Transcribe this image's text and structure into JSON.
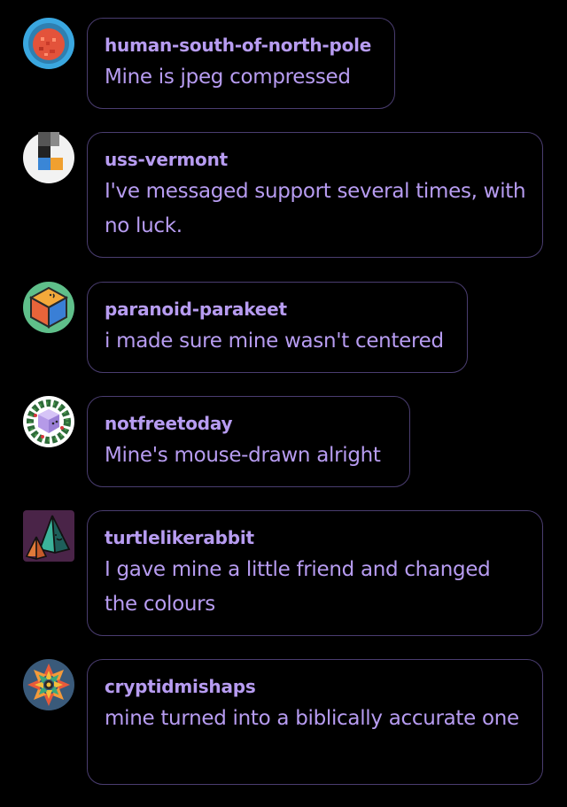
{
  "replies": [
    {
      "username": "human-south-of-north-pole",
      "message": "Mine is jpeg compressed",
      "avatar_icon": "red-blob-avatar-icon"
    },
    {
      "username": "uss-vermont",
      "message": "I've messaged support several times, with no luck.",
      "avatar_icon": "color-blocks-avatar-icon"
    },
    {
      "username": "paranoid-parakeet",
      "message": "i made sure mine wasn't centered",
      "avatar_icon": "isometric-cube-avatar-icon"
    },
    {
      "username": "notfreetoday",
      "message": "Mine's mouse-drawn alright",
      "avatar_icon": "wreath-cube-avatar-icon"
    },
    {
      "username": "turtlelikerabbit",
      "message": "I gave mine a little friend and changed the colours",
      "avatar_icon": "pyramid-friends-avatar-icon"
    },
    {
      "username": "cryptidmishaps",
      "message": "mine turned into a biblically accurate one",
      "avatar_icon": "kaleidoscope-avatar-icon"
    }
  ],
  "colors": {
    "background": "#000000",
    "text": "#b79cf1",
    "bubble_border": "#4a3d70"
  }
}
